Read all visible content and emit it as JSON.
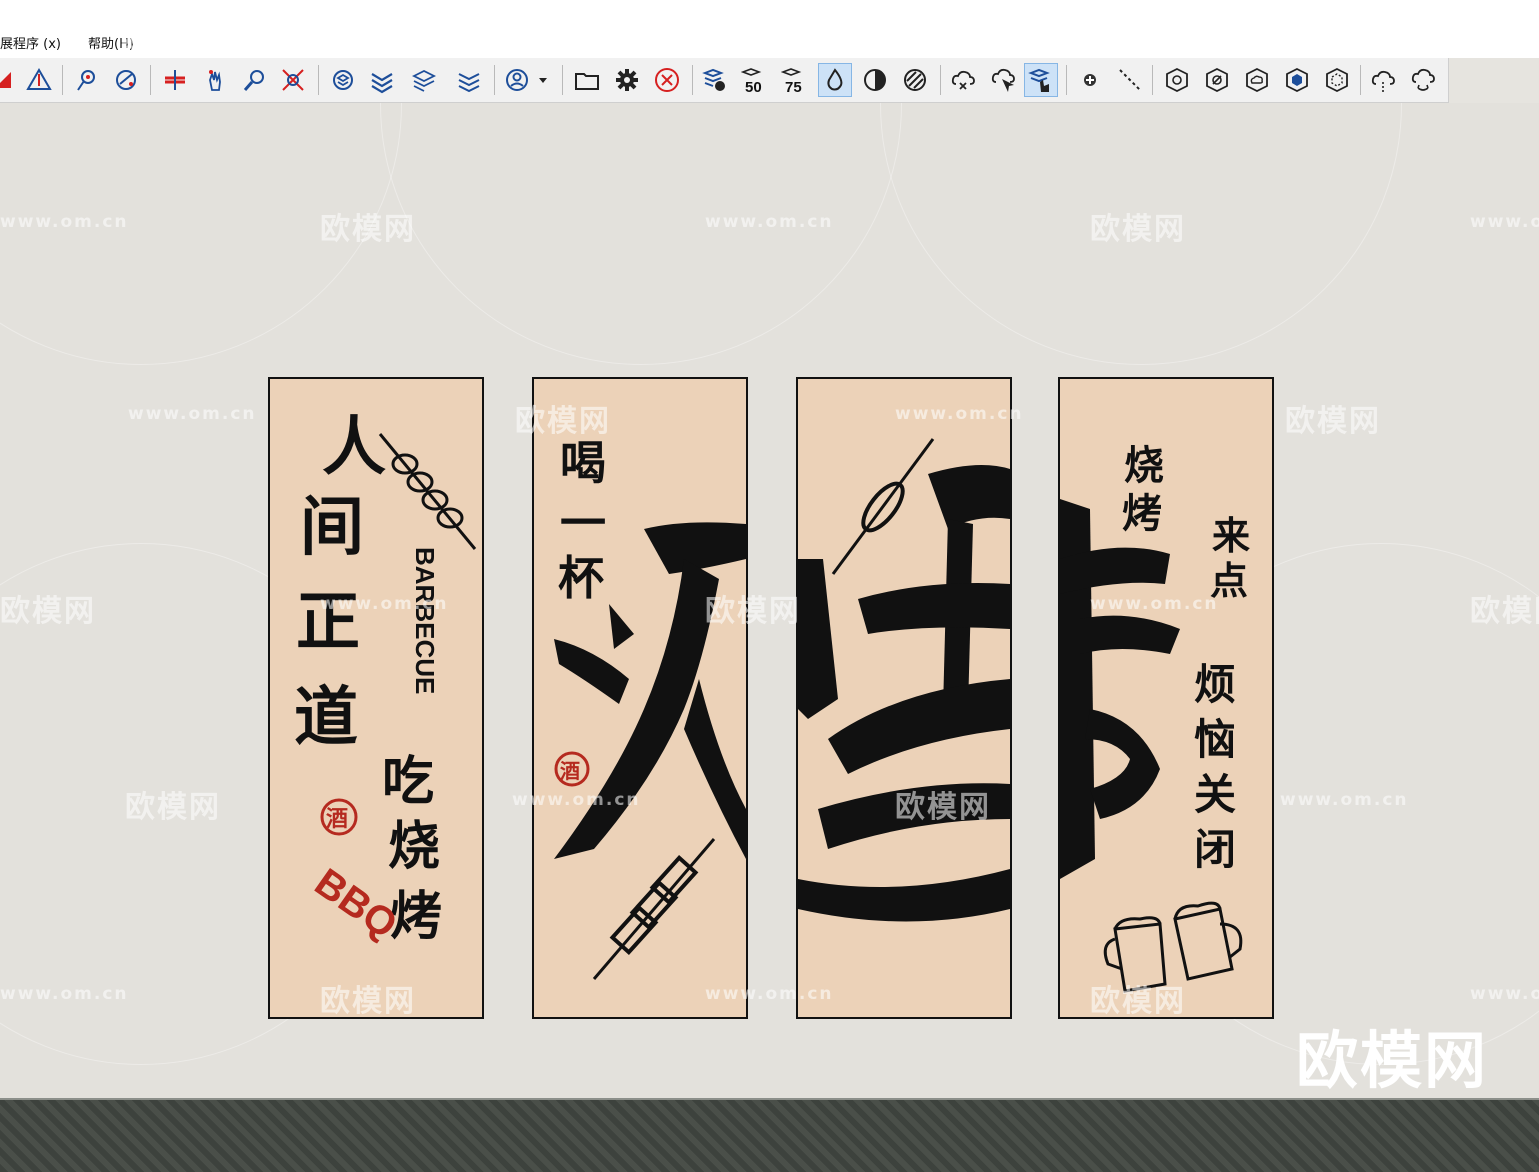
{
  "menu": {
    "items": [
      {
        "label": "展程序 (x)"
      },
      {
        "label": "帮助(H)"
      }
    ]
  },
  "toolbar": {
    "buttons": [
      {
        "name": "red-triangle-icon"
      },
      {
        "name": "warning-triangle-icon"
      },
      {
        "name": "pin-locate-icon"
      },
      {
        "name": "refresh-sphere-icon"
      },
      {
        "name": "section-plane-icon"
      },
      {
        "name": "hand-pointer-icon"
      },
      {
        "name": "magnifier-icon"
      },
      {
        "name": "zoom-extents-icon"
      },
      {
        "name": "layer-stack-icon"
      },
      {
        "name": "cross-lines-icon"
      },
      {
        "name": "layer-eraser-icon"
      },
      {
        "name": "layer-settings-icon"
      },
      {
        "name": "user-avatar-icon"
      },
      {
        "name": "folder-open-icon"
      },
      {
        "name": "gear-icon"
      },
      {
        "name": "close-circle-icon"
      },
      {
        "name": "layer-eye-icon"
      },
      {
        "name": "opacity-50-icon",
        "text": "50"
      },
      {
        "name": "opacity-75-icon",
        "text": "75"
      },
      {
        "name": "drop-icon",
        "active": true
      },
      {
        "name": "contrast-half-icon"
      },
      {
        "name": "striped-circle-icon"
      },
      {
        "name": "cloud-x-icon"
      },
      {
        "name": "cloud-pointer-icon"
      },
      {
        "name": "layer-hand-icon",
        "active": true
      },
      {
        "name": "plus-dot-icon"
      },
      {
        "name": "dashed-line-icon"
      },
      {
        "name": "hexagon-clock-icon"
      },
      {
        "name": "hexagon-slash-icon"
      },
      {
        "name": "hexagon-cloud-icon"
      },
      {
        "name": "hexagon-cube-icon"
      },
      {
        "name": "hexagon-dashed-icon"
      },
      {
        "name": "cloud-dashed-icon"
      },
      {
        "name": "cloud-sync-icon"
      }
    ]
  },
  "panels": [
    {
      "texts": [
        "人间正道",
        "吃烧烤",
        "BARBECUE",
        "酒",
        "BBQ"
      ]
    },
    {
      "texts": [
        "喝一杯",
        "酒"
      ]
    },
    {
      "texts": []
    },
    {
      "texts": [
        "烧烤",
        "来点",
        "烦恼关闭"
      ]
    }
  ],
  "watermark": {
    "brand": "欧模网",
    "url": "www.om.cn"
  },
  "corner_logo": "欧模网"
}
